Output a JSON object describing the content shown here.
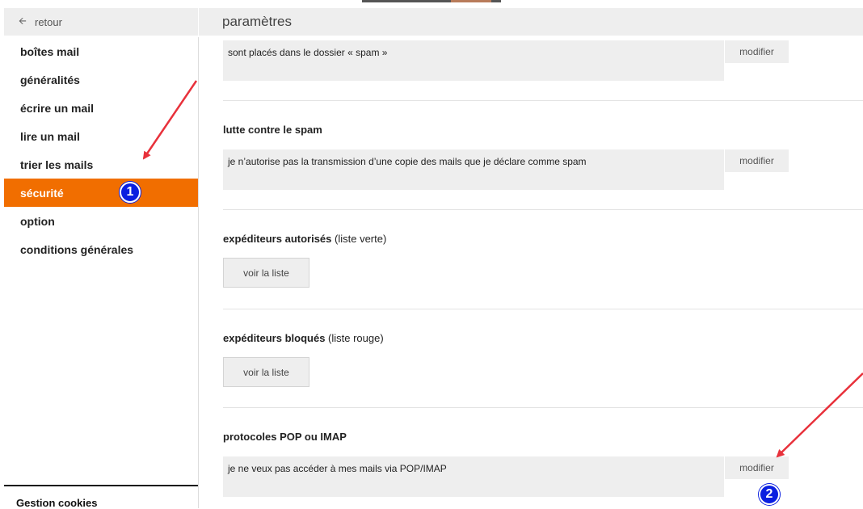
{
  "header": {
    "back_label": "retour",
    "title": "paramètres"
  },
  "sidebar": {
    "items": [
      {
        "label": "boîtes mail"
      },
      {
        "label": "généralités"
      },
      {
        "label": "écrire un mail"
      },
      {
        "label": "lire un mail"
      },
      {
        "label": "trier les mails"
      },
      {
        "label": "sécurité",
        "active": true
      },
      {
        "label": "option"
      },
      {
        "label": "conditions générales"
      }
    ],
    "footer_link": "Gestion cookies"
  },
  "sections": {
    "spam_folder": {
      "value": "sont placés dans le dossier « spam »",
      "button": "modifier"
    },
    "spam_fight": {
      "title": "lutte contre le spam",
      "value": "je n’autorise pas la transmission d’une copie des mails que je déclare comme spam",
      "button": "modifier"
    },
    "allowed_senders": {
      "title": "expéditeurs autorisés",
      "subtitle": "(liste verte)",
      "button": "voir la liste"
    },
    "blocked_senders": {
      "title": "expéditeurs bloqués",
      "subtitle": "(liste rouge)",
      "button": "voir la liste"
    },
    "pop_imap": {
      "title": "protocoles POP ou IMAP",
      "value": "je ne veux pas accéder à mes mails via POP/IMAP",
      "button": "modifier"
    }
  },
  "annotations": {
    "badge1": "1",
    "badge2": "2"
  },
  "colors": {
    "accent": "#f16e00",
    "arrow": "#e8313b",
    "badge": "#0a1fe0"
  }
}
